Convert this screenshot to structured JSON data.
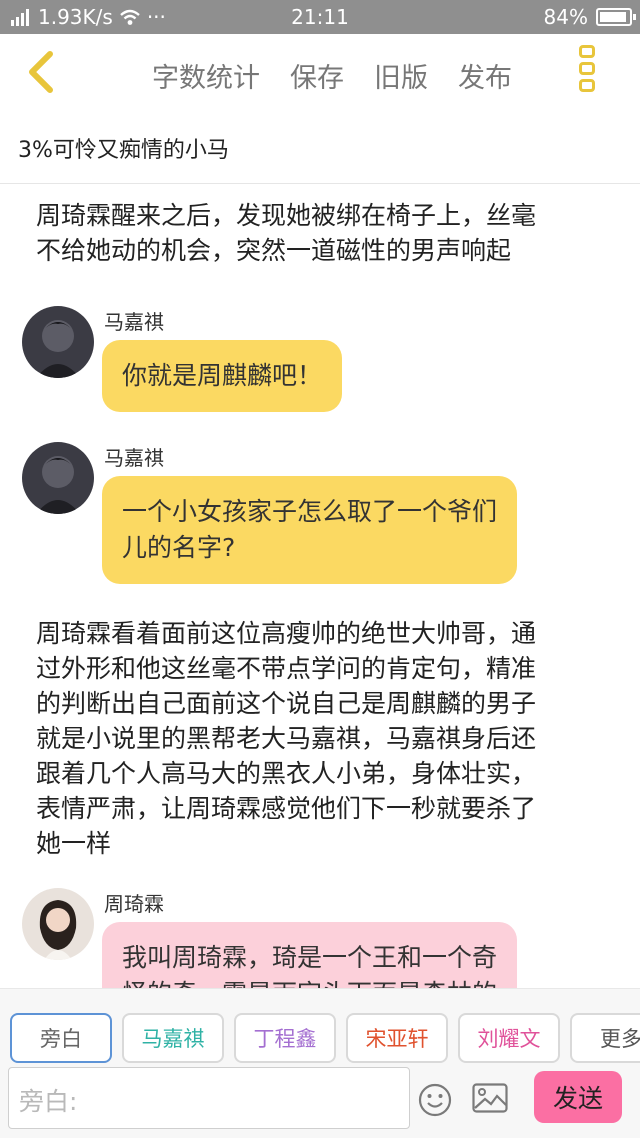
{
  "status_bar": {
    "speed": "1.93K/s",
    "time": "21:11",
    "battery": "84%"
  },
  "toolbar": {
    "word_count": "字数统计",
    "save": "保存",
    "old_version": "旧版",
    "publish": "发布"
  },
  "chapter_title": "3%可怜又痴情的小马",
  "content": {
    "narration_1": [
      "周琦霖醒来之后，发现她被绑在椅子上，丝毫",
      "不给她动的机会，突然一道磁性的男声响起"
    ],
    "message_1": {
      "speaker": "马嘉祺",
      "text": "你就是周麒麟吧！"
    },
    "message_2": {
      "speaker": "马嘉祺",
      "lines": [
        "一个小女孩家子怎么取了一个爷们",
        "儿的名字?"
      ]
    },
    "narration_2": [
      "周琦霖看着面前这位高瘦帅的绝世大帅哥，通",
      "过外形和他这丝毫不带点学问的肯定句，精准",
      "的判断出自己面前这个说自己是周麒麟的男子",
      "就是小说里的黑帮老大马嘉祺，马嘉祺身后还",
      "跟着几个人高马大的黑衣人小弟，身体壮实，",
      "表情严肃，让周琦霖感觉他们下一秒就要杀了",
      "她一样"
    ],
    "message_3": {
      "speaker": "周琦霖",
      "lines": [
        "我叫周琦霖，琦是一个王和一个奇",
        "怪的奇，霖是雨字头下面是森林的"
      ]
    }
  },
  "roles": [
    {
      "label": "旁白",
      "color": "#666666"
    },
    {
      "label": "马嘉祺",
      "color": "#2fb2a5"
    },
    {
      "label": "丁程鑫",
      "color": "#a46fd1"
    },
    {
      "label": "宋亚轩",
      "color": "#e0522e"
    },
    {
      "label": "刘耀文",
      "color": "#e0529a"
    },
    {
      "label": "更多",
      "color": "#555555"
    }
  ],
  "input": {
    "placeholder": "旁白:"
  },
  "send_label": "发送",
  "accent_color": "#e8c53b"
}
